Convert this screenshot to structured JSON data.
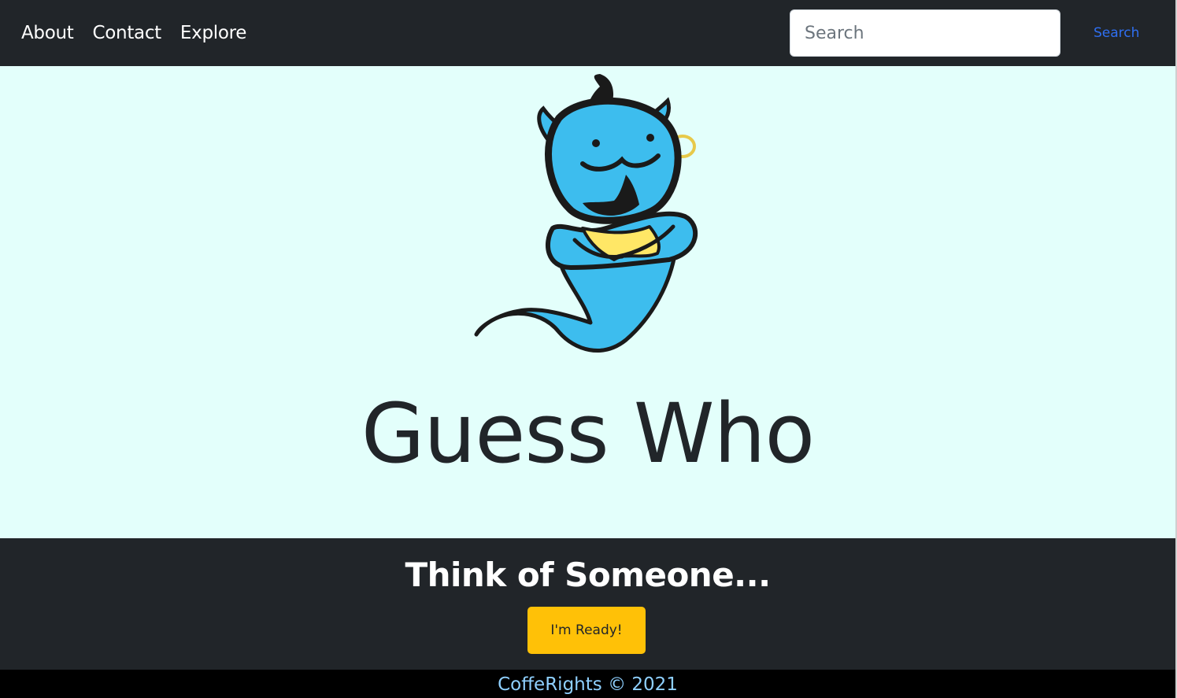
{
  "nav": {
    "links": [
      "About",
      "Contact",
      "Explore"
    ]
  },
  "search": {
    "placeholder": "Search",
    "value": "",
    "button_label": "Search"
  },
  "hero": {
    "logo_icon": "genie-mascot-icon",
    "title": "Guess Who"
  },
  "cta": {
    "heading": "Think of Someone...",
    "button_label": "I'm Ready!"
  },
  "footer": {
    "text": "CoffeRights © 2021"
  },
  "colors": {
    "navbar_bg": "#212529",
    "hero_bg": "#e3fffb",
    "accent_button": "#ffc107",
    "search_link": "#2f6ff1",
    "footer_text": "#8fd0ff",
    "genie_blue": "#3dbdee",
    "genie_yellow": "#ffe766"
  }
}
